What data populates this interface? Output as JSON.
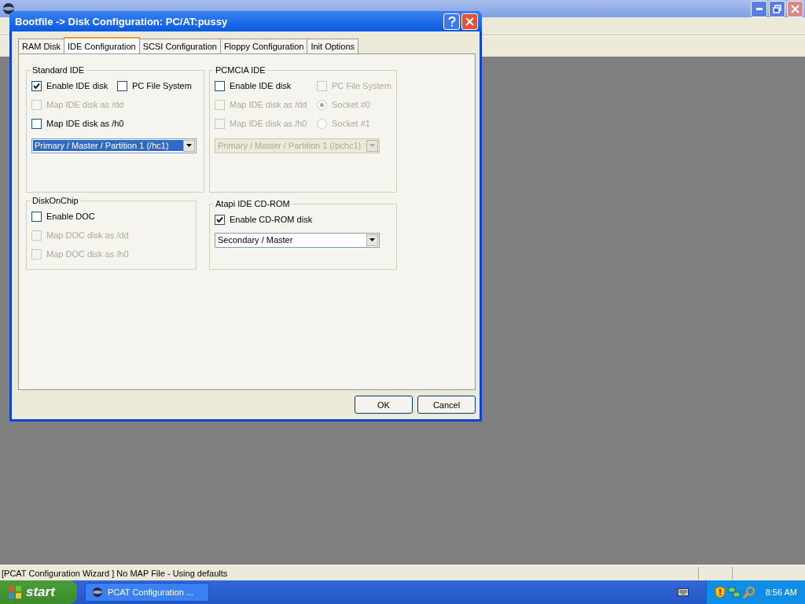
{
  "main_window": {
    "status_bar": "[PCAT Configuration Wizard ] No MAP File - Using defaults"
  },
  "dialog": {
    "title": "Bootfile -> Disk Configuration: PC/AT:pussy",
    "tabs": [
      {
        "label": "RAM Disk",
        "selected": false
      },
      {
        "label": "IDE Configuration",
        "selected": true
      },
      {
        "label": "SCSI Configuration",
        "selected": false
      },
      {
        "label": "Floppy Configuration",
        "selected": false
      },
      {
        "label": "Init Options",
        "selected": false
      }
    ],
    "groups": [
      {
        "title": "Standard IDE",
        "rows": [
          [
            {
              "kind": "checkbox",
              "label": "Enable IDE disk",
              "checked": true,
              "disabled": false
            },
            {
              "kind": "checkbox",
              "label": "PC File System",
              "checked": false,
              "disabled": false
            }
          ],
          [
            {
              "kind": "checkbox",
              "label": "Map IDE disk as /dd",
              "checked": false,
              "disabled": true
            }
          ],
          [
            {
              "kind": "checkbox",
              "label": "Map IDE disk as /h0",
              "checked": false,
              "disabled": false
            }
          ],
          [
            {
              "kind": "dropdown",
              "value": "Primary / Master / Partition 1 (/hc1)",
              "disabled": false,
              "focused": true
            }
          ]
        ]
      },
      {
        "title": "PCMCIA IDE",
        "rows": [
          [
            {
              "kind": "checkbox",
              "label": "Enable IDE disk",
              "checked": false,
              "disabled": false
            },
            {
              "kind": "checkbox",
              "label": "PC File System",
              "checked": false,
              "disabled": true
            }
          ],
          [
            {
              "kind": "checkbox",
              "label": "Map IDE disk as /dd",
              "checked": false,
              "disabled": true
            },
            {
              "kind": "radio",
              "label": "Socket #0",
              "selected": true,
              "disabled": true
            }
          ],
          [
            {
              "kind": "checkbox",
              "label": "Map IDE disk as /h0",
              "checked": false,
              "disabled": true
            },
            {
              "kind": "radio",
              "label": "Socket #1",
              "selected": false,
              "disabled": true
            }
          ],
          [
            {
              "kind": "dropdown",
              "value": "Primary / Master / Partition 1 (/pchc1)",
              "disabled": true,
              "focused": false
            }
          ]
        ]
      },
      {
        "title": "DiskOnChip",
        "rows": [
          [
            {
              "kind": "checkbox",
              "label": "Enable DOC",
              "checked": false,
              "disabled": false
            }
          ],
          [
            {
              "kind": "checkbox",
              "label": "Map DOC disk as /dd",
              "checked": false,
              "disabled": true
            }
          ],
          [
            {
              "kind": "checkbox",
              "label": "Map DOC disk as /h0",
              "checked": false,
              "disabled": true
            }
          ]
        ]
      },
      {
        "title": "Atapi IDE CD-ROM",
        "rows": [
          [
            {
              "kind": "checkbox",
              "label": "Enable CD-ROM disk",
              "checked": true,
              "disabled": false
            }
          ],
          [
            {
              "kind": "dropdown",
              "value": "Secondary / Master",
              "disabled": false,
              "focused": false
            }
          ]
        ]
      }
    ],
    "buttons": [
      "OK",
      "Cancel"
    ]
  },
  "taskbar": {
    "start": "start",
    "tasks": [
      {
        "label": "PCAT Configuration ...",
        "selected": false
      }
    ],
    "clock": "8:56 AM"
  }
}
